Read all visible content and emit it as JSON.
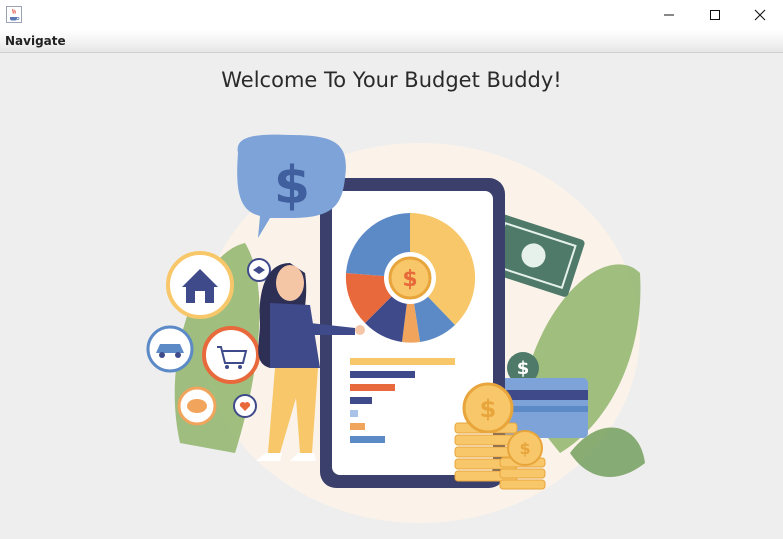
{
  "window": {
    "icon": "java-coffee-icon",
    "controls": [
      "minimize-icon",
      "maximize-icon",
      "close-icon"
    ]
  },
  "menubar": {
    "items": [
      {
        "label": "Navigate"
      }
    ]
  },
  "main": {
    "heading": "Welcome To Your Budget Buddy!",
    "illustration": {
      "speech_bubble_symbol": "$",
      "coin_symbol": "$",
      "pie_segments": [
        {
          "color": "#f7c76a"
        },
        {
          "color": "#5c8ac7"
        },
        {
          "color": "#e86a3c"
        },
        {
          "color": "#3f4a8a"
        },
        {
          "color": "#a9c3e8"
        }
      ],
      "bar_colors": [
        "#f7c76a",
        "#3f4a8a",
        "#e86a3c",
        "#3f4a8a",
        "#a9c3e8",
        "#f0a45c",
        "#5c8ac7"
      ]
    }
  },
  "colors": {
    "background": "#eeeeee",
    "phone_frame": "#3a3f6b",
    "accent_blue": "#5c8ac7",
    "accent_yellow": "#f7c76a",
    "accent_orange": "#e86a3c",
    "leaf_green": "#8fb46a"
  }
}
